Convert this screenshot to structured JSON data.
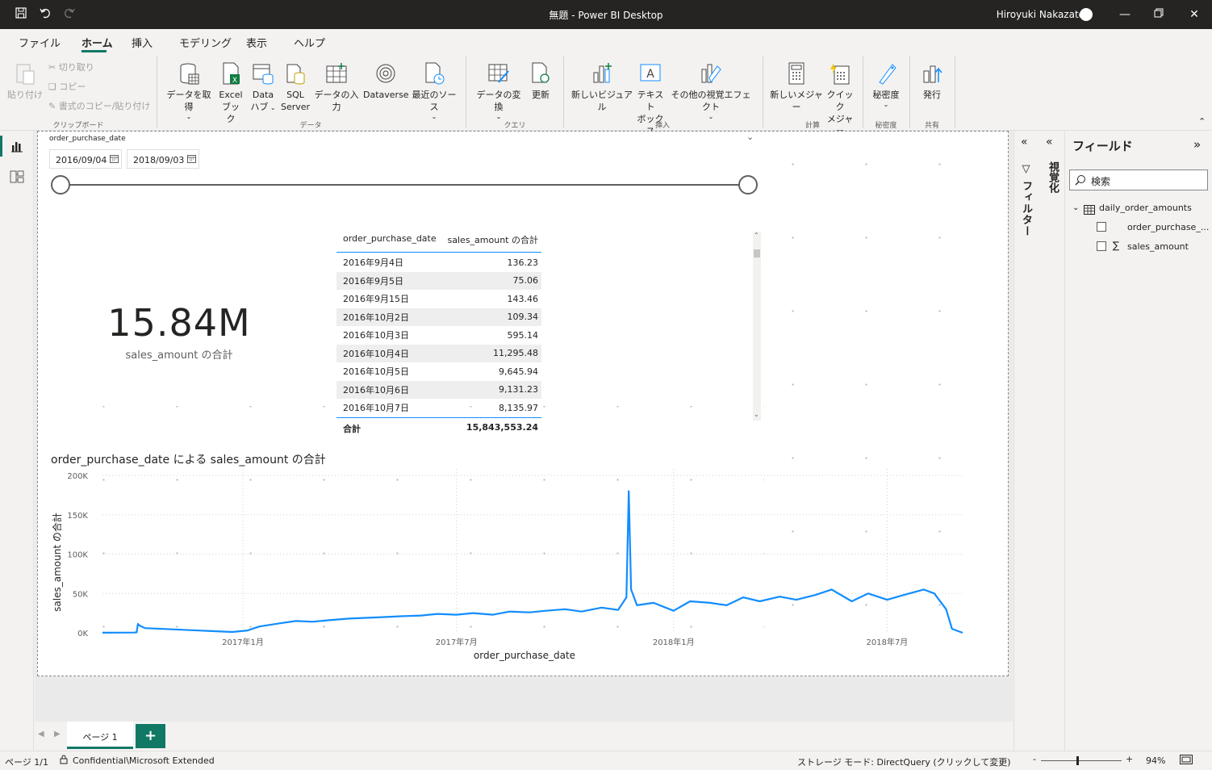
{
  "window": {
    "title": "無題 - Power BI Desktop",
    "user": "Hiroyuki Nakazato"
  },
  "menu_tabs": [
    "ファイル",
    "ホーム",
    "挿入",
    "モデリング",
    "表示",
    "ヘルプ"
  ],
  "ribbon": {
    "clipboard": {
      "paste": "貼り付け",
      "cut": "切り取り",
      "copy": "コピー",
      "format_painter": "書式のコピー/貼り付け",
      "label": "クリップボード"
    },
    "data": {
      "get_data": "データを取得",
      "excel_1": "Excel",
      "excel_2": "ブック",
      "datahub_1": "Data",
      "datahub_2": "ハブ",
      "sql_1": "SQL",
      "sql_2": "Server",
      "enter_data": "データの入力",
      "dataverse": "Dataverse",
      "recent": "最近のソース",
      "label": "データ"
    },
    "query": {
      "transform": "データの変換",
      "refresh": "更新",
      "label": "クエリ"
    },
    "insert": {
      "new_visual": "新しいビジュアル",
      "textbox_1": "テキスト",
      "textbox_2": "ボックス",
      "more_visuals": "その他の視覚エフェクト",
      "label": "挿入"
    },
    "calc": {
      "new_measure": "新しいメジャー",
      "quick_1": "クイック",
      "quick_2": "メジャー",
      "label": "計算"
    },
    "sensitivity": {
      "btn": "秘密度",
      "label": "秘密度"
    },
    "share": {
      "publish": "発行",
      "label": "共有"
    }
  },
  "slicer": {
    "title": "order_purchase_date",
    "start": "2016/09/04",
    "end": "2018/09/03"
  },
  "card": {
    "value": "15.84M",
    "label": "sales_amount の合計"
  },
  "table": {
    "headers": [
      "order_purchase_date",
      "sales_amount の合計"
    ],
    "rows": [
      [
        "2016年9月4日",
        "136.23"
      ],
      [
        "2016年9月5日",
        "75.06"
      ],
      [
        "2016年9月15日",
        "143.46"
      ],
      [
        "2016年10月2日",
        "109.34"
      ],
      [
        "2016年10月3日",
        "595.14"
      ],
      [
        "2016年10月4日",
        "11,295.48"
      ],
      [
        "2016年10月5日",
        "9,645.94"
      ],
      [
        "2016年10月6日",
        "9,131.23"
      ],
      [
        "2016年10月7日",
        "8,135.97"
      ]
    ],
    "total_label": "合計",
    "total_value": "15,843,553.24"
  },
  "chart_data": {
    "type": "line",
    "title": "order_purchase_date による sales_amount の合計",
    "xlabel": "order_purchase_date",
    "ylabel": "sales_amount の合計",
    "y_ticks": [
      "0K",
      "50K",
      "100K",
      "150K",
      "200K"
    ],
    "x_ticks": [
      "2017年1月",
      "2017年7月",
      "2018年1月",
      "2018年7月"
    ],
    "ylim": [
      0,
      200000
    ],
    "xlim": [
      "2016-09-04",
      "2018-09-03"
    ],
    "color": "#118dff",
    "grid": true,
    "series": [
      {
        "x": [
          "2016-09-04",
          "2016-10-01",
          "2016-10-03",
          "2016-10-04",
          "2016-10-05",
          "2016-10-10",
          "2016-12-23",
          "2017-01-05",
          "2017-01-15",
          "2017-02-01",
          "2017-02-15",
          "2017-03-01",
          "2017-03-15",
          "2017-04-01",
          "2017-04-15",
          "2017-05-01",
          "2017-05-15",
          "2017-06-01",
          "2017-06-15",
          "2017-07-01",
          "2017-07-15",
          "2017-08-01",
          "2017-08-15",
          "2017-09-01",
          "2017-09-15",
          "2017-10-01",
          "2017-10-15",
          "2017-11-01",
          "2017-11-15",
          "2017-11-22",
          "2017-11-24",
          "2017-11-26",
          "2017-12-01",
          "2017-12-15",
          "2018-01-01",
          "2018-01-15",
          "2018-02-01",
          "2018-02-15",
          "2018-03-01",
          "2018-03-15",
          "2018-04-01",
          "2018-04-15",
          "2018-05-01",
          "2018-05-15",
          "2018-06-01",
          "2018-06-15",
          "2018-07-01",
          "2018-07-15",
          "2018-08-01",
          "2018-08-10",
          "2018-08-20",
          "2018-08-25",
          "2018-09-03"
        ],
        "values": [
          136,
          300,
          600,
          11300,
          9600,
          6000,
          1000,
          3000,
          8000,
          12000,
          15000,
          14000,
          16000,
          18000,
          19000,
          20000,
          21000,
          22000,
          24000,
          23000,
          25000,
          23000,
          27000,
          26000,
          28000,
          30000,
          27000,
          32000,
          29000,
          45000,
          180000,
          55000,
          35000,
          38000,
          28000,
          40000,
          38000,
          35000,
          45000,
          40000,
          46000,
          42000,
          48000,
          55000,
          40000,
          50000,
          42000,
          48000,
          55000,
          50000,
          30000,
          5000,
          0
        ]
      }
    ]
  }
}
